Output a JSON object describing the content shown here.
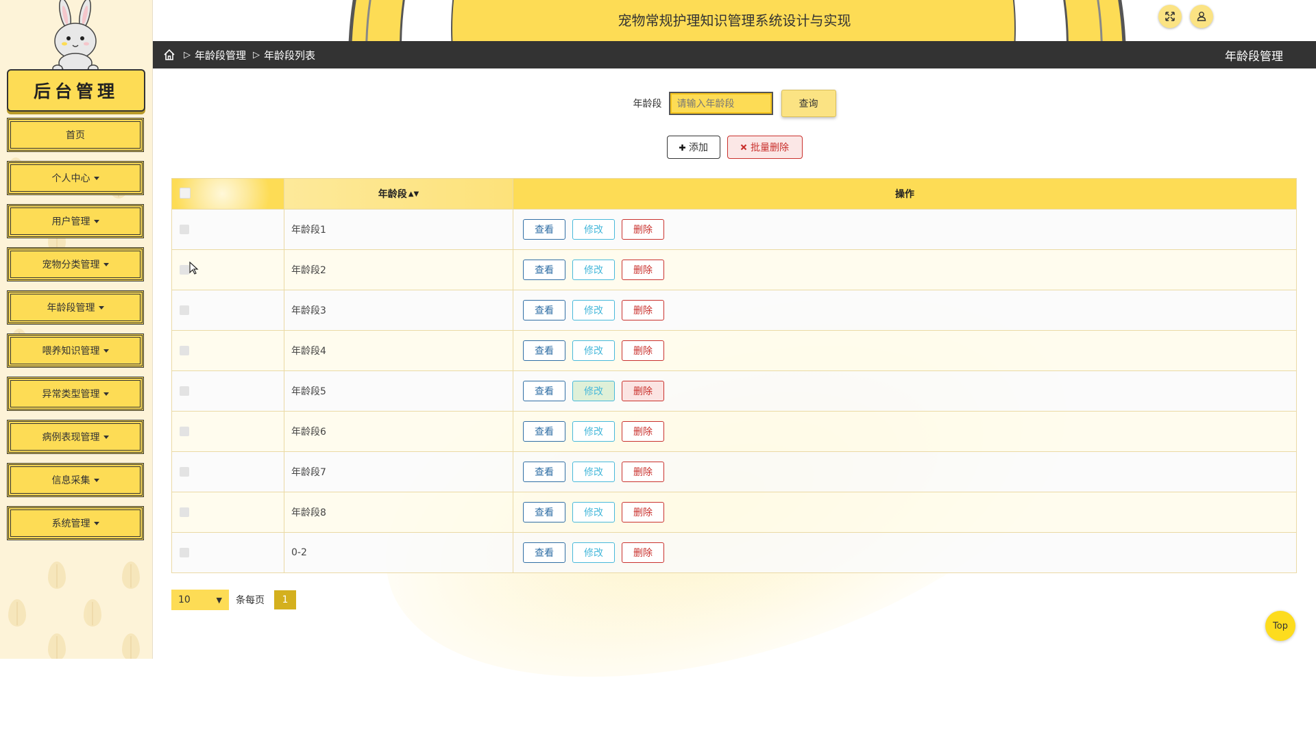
{
  "sidebar": {
    "brand": "后台管理",
    "items": [
      {
        "label": "首页",
        "has_caret": false
      },
      {
        "label": "个人中心",
        "has_caret": true
      },
      {
        "label": "用户管理",
        "has_caret": true
      },
      {
        "label": "宠物分类管理",
        "has_caret": true
      },
      {
        "label": "年龄段管理",
        "has_caret": true
      },
      {
        "label": "喂养知识管理",
        "has_caret": true
      },
      {
        "label": "异常类型管理",
        "has_caret": true
      },
      {
        "label": "病例表现管理",
        "has_caret": true
      },
      {
        "label": "信息采集",
        "has_caret": true
      },
      {
        "label": "系统管理",
        "has_caret": true
      }
    ]
  },
  "header": {
    "title": "宠物常规护理知识管理系统设计与实现",
    "fullscreen_icon": "expand-icon",
    "user_icon": "user-icon"
  },
  "breadcrumb": {
    "items": [
      "年龄段管理",
      "年龄段列表"
    ],
    "right_title": "年龄段管理"
  },
  "search": {
    "label": "年龄段",
    "placeholder": "请输入年龄段",
    "value": "",
    "button": "查询"
  },
  "actions": {
    "add": "添加",
    "batch_delete": "批量删除"
  },
  "table": {
    "headers": [
      "",
      "年龄段",
      "操作"
    ],
    "rows": [
      {
        "age_range": "年龄段1"
      },
      {
        "age_range": "年龄段2"
      },
      {
        "age_range": "年龄段3"
      },
      {
        "age_range": "年龄段4"
      },
      {
        "age_range": "年龄段5"
      },
      {
        "age_range": "年龄段6"
      },
      {
        "age_range": "年龄段7"
      },
      {
        "age_range": "年龄段8"
      },
      {
        "age_range": "0-2"
      }
    ],
    "row_actions": {
      "view": "查看",
      "edit": "修改",
      "delete": "删除"
    }
  },
  "pagination": {
    "page_size": "10",
    "per_page_label": "条每页",
    "current_page": "1"
  },
  "back_to_top": "Top",
  "colors": {
    "accent": "#fddc55",
    "dark_bar": "#333333",
    "view": "#2e6da4",
    "edit": "#46b8da",
    "delete": "#c9302c"
  }
}
